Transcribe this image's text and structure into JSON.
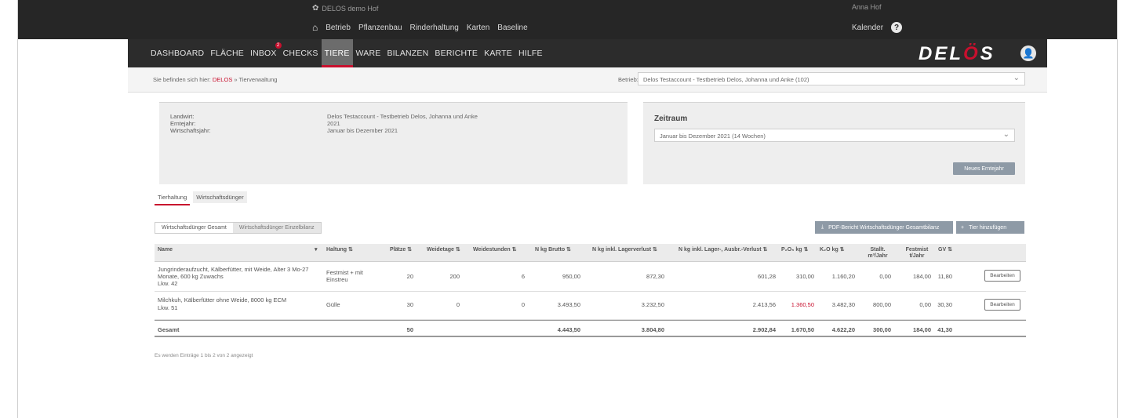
{
  "topbar": {
    "org_text": "DELOS demo Hof",
    "user_text": "Anna Hof",
    "nav": [
      "Betrieb",
      "Pflanzenbau",
      "Rinderhaltung",
      "Karten",
      "Baseline"
    ],
    "calendar": "Kalender",
    "help": "?"
  },
  "mainnav": {
    "items": [
      "DASHBOARD",
      "FLÄCHE",
      "INBOX",
      "CHECKS",
      "TIERE",
      "WARE",
      "BILANZEN",
      "BERICHTE",
      "KARTE",
      "HILFE"
    ],
    "active": "TIERE",
    "badge": "2",
    "logo_pre": "DEL",
    "logo_accent": "Ö",
    "logo_post": "S"
  },
  "crumb": {
    "prefix": "Sie befinden sich hier: ",
    "highlight": "DELOS",
    "suffix": " » Tierverwaltung",
    "betrieb_label": "Betrieb:",
    "betrieb_value": "Delos Testaccount - Testbetrieb Delos, Johanna und Anke (102)"
  },
  "info": {
    "labels": [
      "Landwirt:",
      "Erntejahr:",
      "Wirtschaftsjahr:"
    ],
    "values": [
      "Delos Testaccount - Testbetrieb Delos, Johanna und Anke",
      "2021",
      "Januar bis Dezember 2021"
    ]
  },
  "zeitraum": {
    "title": "Zeitraum",
    "value": "Januar bis Dezember 2021 (14 Wochen)",
    "button": "Neues Erntejahr"
  },
  "tabs": [
    "Tierhaltung",
    "Wirtschaftsdünger"
  ],
  "subtoggle": [
    "Wirtschaftsdünger Gesamt",
    "Wirtschaftsdünger Einzelbilanz"
  ],
  "buttons": {
    "pdf": "PDF-Bericht Wirtschaftsdünger Gesamtbilanz",
    "add": "Tier hinzufügen",
    "edit": "Bearbeiten"
  },
  "table": {
    "headers": [
      "Name",
      "Haltung",
      "Plätze",
      "Weidetage",
      "Weidestunden",
      "N kg Brutto",
      "N kg inkl. Lagerverlust",
      "N kg inkl. Lager-, Ausbr.-Verlust",
      "P₂O₅ kg",
      "K₂O kg",
      "Stallt. m³/Jahr",
      "Festmist t/Jahr",
      "GV"
    ],
    "rows": [
      {
        "name": "Jungrinderaufzucht, Kälberfütter, mit Weide, Alter 3 Mo-27 Monate, 600 kg Zuwachs",
        "name2": "Lkw. 42",
        "haltung": "Festmist + mit Einstreu",
        "plaetze": "20",
        "weidetage": "200",
        "weidestunden": "6",
        "n_brutto": "950,00",
        "n_lager": "872,30",
        "n_ausbr": "601,28",
        "p2o5": "310,00",
        "k2o": "1.160,20",
        "stall": "0,00",
        "festmist": "184,00",
        "gv": "11,80"
      },
      {
        "name": "Milchkuh, Kälberfütter ohne Weide, 8000 kg ECM",
        "name2": "Lkw. 51",
        "haltung": "Gülle",
        "plaetze": "30",
        "weidetage": "0",
        "weidestunden": "0",
        "n_brutto": "3.493,50",
        "n_lager": "3.232,50",
        "n_ausbr": "2.413,56",
        "p2o5": "1.360,50",
        "k2o": "3.482,30",
        "stall": "800,00",
        "festmist": "0,00",
        "gv": "30,30"
      }
    ],
    "total": {
      "label": "Gesamt",
      "plaetze": "50",
      "n_brutto": "4.443,50",
      "n_lager": "3.804,80",
      "n_ausbr": "2.902,84",
      "p2o5": "1.670,50",
      "k2o": "4.622,20",
      "stall": "300,00",
      "festmist": "184,00",
      "gv": "41,30"
    },
    "footnote": "Es werden Einträge 1 bis 2 von 2 angezeigt"
  }
}
